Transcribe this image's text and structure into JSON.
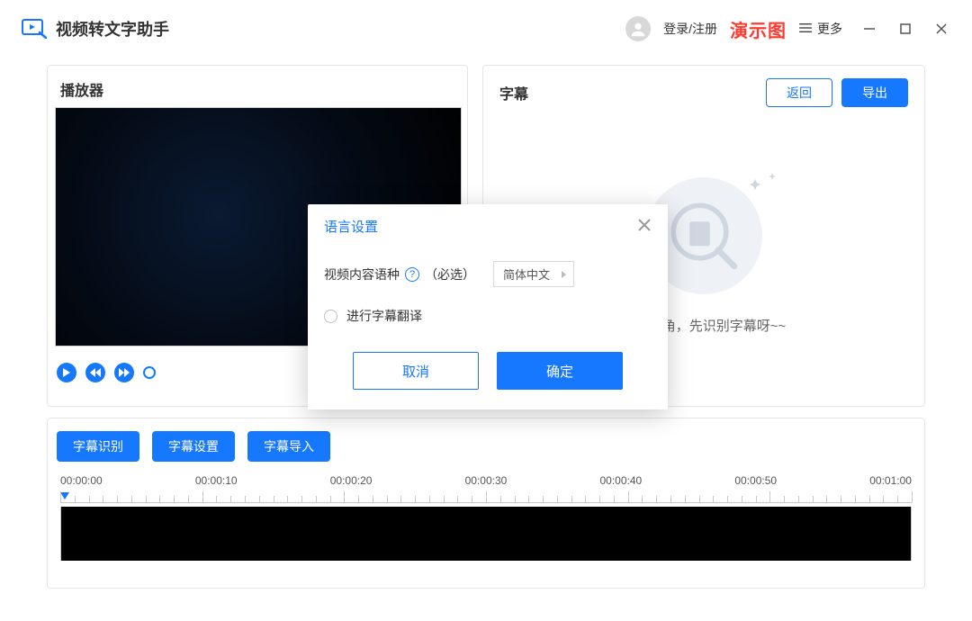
{
  "header": {
    "app_title": "视频转文字助手",
    "login_text": "登录/注册",
    "demo_badge": "演示图",
    "more_label": "更多"
  },
  "player": {
    "title": "播放器"
  },
  "subtitle": {
    "title": "字幕",
    "return_label": "返回",
    "export_label": "导出",
    "empty_text": "戳左下角，先识别字幕呀~~"
  },
  "timeline": {
    "toolbar": {
      "recognize": "字幕识别",
      "settings": "字幕设置",
      "import": "字幕导入"
    },
    "labels": [
      "00:00:00",
      "00:00:10",
      "00:00:20",
      "00:00:30",
      "00:00:40",
      "00:00:50",
      "00:01:00"
    ]
  },
  "modal": {
    "title": "语言设置",
    "lang_label": "视频内容语种",
    "required_label": "（必选）",
    "select_value": "简体中文",
    "translate_label": "进行字幕翻译",
    "cancel": "取消",
    "ok": "确定"
  }
}
